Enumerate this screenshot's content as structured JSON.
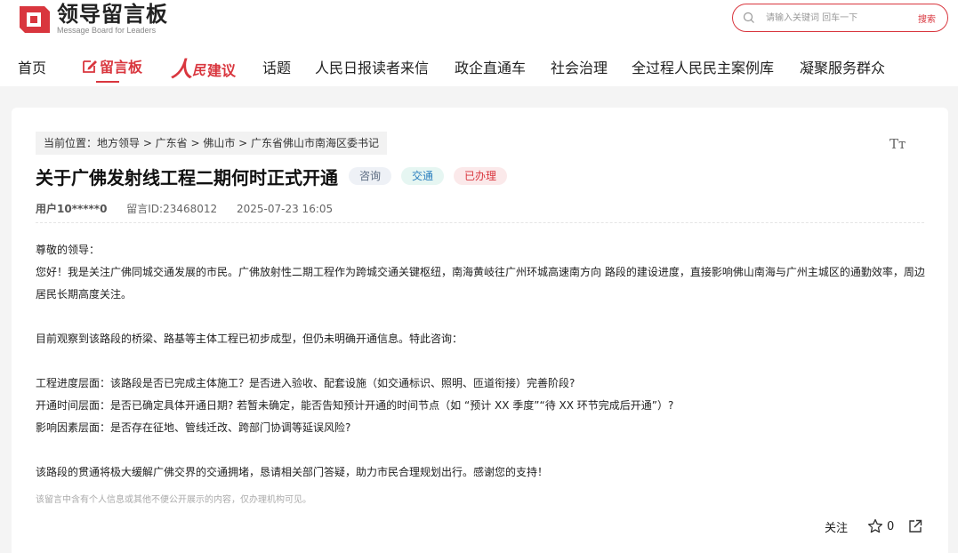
{
  "logo": {
    "title": "领导留言板",
    "subtitle": "Message Board for Leaders"
  },
  "search": {
    "placeholder": "请输入关键词 回车一下",
    "button": "搜索"
  },
  "nav": {
    "home": "首页",
    "message_board": "留言板",
    "jianyi": {
      "ren": "人",
      "min": "民",
      "label": "建议"
    },
    "topics": "话题",
    "letters": "人民日报读者来信",
    "gov_enterprise": "政企直通车",
    "social": "社会治理",
    "democracy": "全过程人民民主案例库",
    "service": "凝聚服务群众"
  },
  "breadcrumb": "当前位置：地方领导 > 广东省 > 佛山市 > 广东省佛山市南海区委书记",
  "font_size_icon": "Tт",
  "title": "关于广佛发射线工程二期何时正式开通",
  "tags": {
    "consult": "咨询",
    "traffic": "交通",
    "done": "已办理"
  },
  "meta": {
    "user": "用户10*****0",
    "message_id": "留言ID:23468012",
    "time": "2025-07-23 16:05"
  },
  "content": {
    "greeting": "尊敬的领导：",
    "p1": "您好！我是关注广佛同城交通发展的市民。广佛放射性二期工程作为跨城交通关键枢纽，南海黄岐往广州环城高速南方向 路段的建设进度，直接影响佛山南海与广州主城区的通勤效率，周边居民长期高度关注。",
    "p2": "目前观察到该路段的桥梁、路基等主体工程已初步成型，但仍未明确开通信息。特此咨询：",
    "q1": "工程进度层面：该路段是否已完成主体施工？是否进入验收、配套设施（如交通标识、照明、匝道衔接）完善阶段?",
    "q2": "开通时间层面：是否已确定具体开通日期? 若暂未确定，能否告知预计开通的时间节点（如 “预计 XX 季度”“待 XX 环节完成后开通”）?",
    "q3": "影响因素层面：是否存在征地、管线迁改、跨部门协调等延误风险?",
    "closing": "该路段的贯通将极大缓解广佛交界的交通拥堵，恳请相关部门答疑，助力市民合理规划出行。感谢您的支持！"
  },
  "notice": "该留言中含有个人信息或其他不便公开展示的内容，仅办理机构可见。",
  "actions": {
    "follow": "关注",
    "like_count": "0"
  },
  "colors": {
    "accent": "#d9363e"
  }
}
